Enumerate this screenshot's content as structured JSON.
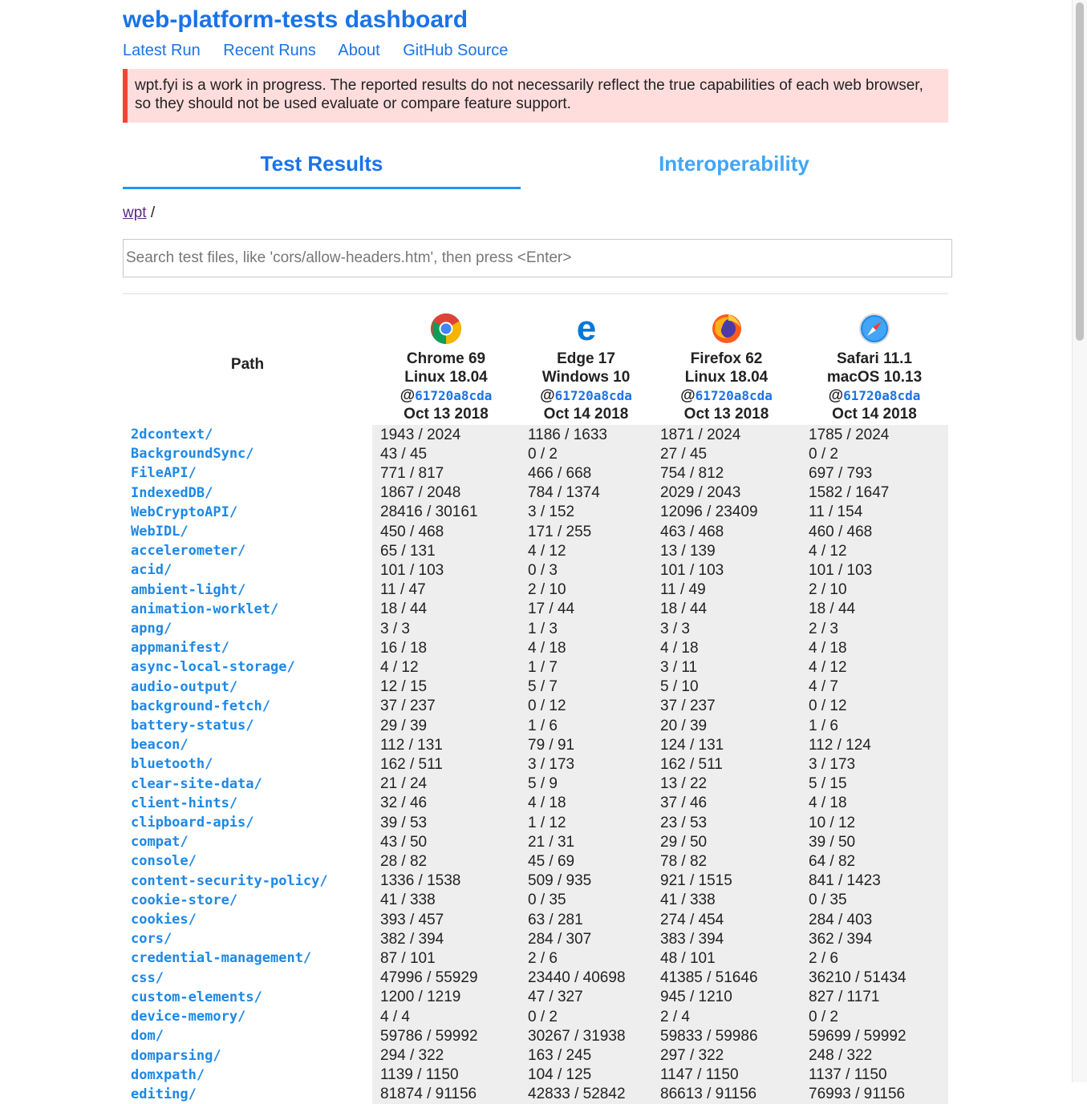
{
  "header": {
    "title": "web-platform-tests dashboard",
    "nav": [
      "Latest Run",
      "Recent Runs",
      "About",
      "GitHub Source"
    ]
  },
  "warning": "wpt.fyi is a work in progress. The reported results do not necessarily reflect the true capabilities of each web browser, so they should not be used evaluate or compare feature support.",
  "tabs": {
    "results": "Test Results",
    "interop": "Interoperability",
    "active": "Test Results"
  },
  "breadcrumb": {
    "root": "wpt",
    "separator": "/"
  },
  "search": {
    "placeholder": "Search test files, like 'cors/allow-headers.htm', then press <Enter>",
    "value": ""
  },
  "table": {
    "path_header": "Path",
    "browsers": [
      {
        "icon": "chrome-icon",
        "name": "Chrome 69",
        "os": "Linux 18.04",
        "at": "@",
        "sha": "61720a8cda",
        "date": "Oct 13 2018"
      },
      {
        "icon": "edge-icon",
        "name": "Edge 17",
        "os": "Windows 10",
        "at": "@",
        "sha": "61720a8cda",
        "date": "Oct 14 2018"
      },
      {
        "icon": "firefox-icon",
        "name": "Firefox 62",
        "os": "Linux 18.04",
        "at": "@",
        "sha": "61720a8cda",
        "date": "Oct 13 2018"
      },
      {
        "icon": "safari-icon",
        "name": "Safari 11.1",
        "os": "macOS 10.13",
        "at": "@",
        "sha": "61720a8cda",
        "date": "Oct 14 2018"
      }
    ],
    "rows": [
      {
        "path": "2dcontext/",
        "results": [
          "1943 / 2024",
          "1186 / 1633",
          "1871 / 2024",
          "1785 / 2024"
        ]
      },
      {
        "path": "BackgroundSync/",
        "results": [
          "43 / 45",
          "0 / 2",
          "27 / 45",
          "0 / 2"
        ]
      },
      {
        "path": "FileAPI/",
        "results": [
          "771 / 817",
          "466 / 668",
          "754 / 812",
          "697 / 793"
        ]
      },
      {
        "path": "IndexedDB/",
        "results": [
          "1867 / 2048",
          "784 / 1374",
          "2029 / 2043",
          "1582 / 1647"
        ]
      },
      {
        "path": "WebCryptoAPI/",
        "results": [
          "28416 / 30161",
          "3 / 152",
          "12096 / 23409",
          "11 / 154"
        ]
      },
      {
        "path": "WebIDL/",
        "results": [
          "450 / 468",
          "171 / 255",
          "463 / 468",
          "460 / 468"
        ]
      },
      {
        "path": "accelerometer/",
        "results": [
          "65 / 131",
          "4 / 12",
          "13 / 139",
          "4 / 12"
        ]
      },
      {
        "path": "acid/",
        "results": [
          "101 / 103",
          "0 / 3",
          "101 / 103",
          "101 / 103"
        ]
      },
      {
        "path": "ambient-light/",
        "results": [
          "11 / 47",
          "2 / 10",
          "11 / 49",
          "2 / 10"
        ]
      },
      {
        "path": "animation-worklet/",
        "results": [
          "18 / 44",
          "17 / 44",
          "18 / 44",
          "18 / 44"
        ]
      },
      {
        "path": "apng/",
        "results": [
          "3 / 3",
          "1 / 3",
          "3 / 3",
          "2 / 3"
        ]
      },
      {
        "path": "appmanifest/",
        "results": [
          "16 / 18",
          "4 / 18",
          "4 / 18",
          "4 / 18"
        ]
      },
      {
        "path": "async-local-storage/",
        "results": [
          "4 / 12",
          "1 / 7",
          "3 / 11",
          "4 / 12"
        ]
      },
      {
        "path": "audio-output/",
        "results": [
          "12 / 15",
          "5 / 7",
          "5 / 10",
          "4 / 7"
        ]
      },
      {
        "path": "background-fetch/",
        "results": [
          "37 / 237",
          "0 / 12",
          "37 / 237",
          "0 / 12"
        ]
      },
      {
        "path": "battery-status/",
        "results": [
          "29 / 39",
          "1 / 6",
          "20 / 39",
          "1 / 6"
        ]
      },
      {
        "path": "beacon/",
        "results": [
          "112 / 131",
          "79 / 91",
          "124 / 131",
          "112 / 124"
        ]
      },
      {
        "path": "bluetooth/",
        "results": [
          "162 / 511",
          "3 / 173",
          "162 / 511",
          "3 / 173"
        ]
      },
      {
        "path": "clear-site-data/",
        "results": [
          "21 / 24",
          "5 / 9",
          "13 / 22",
          "5 / 15"
        ]
      },
      {
        "path": "client-hints/",
        "results": [
          "32 / 46",
          "4 / 18",
          "37 / 46",
          "4 / 18"
        ]
      },
      {
        "path": "clipboard-apis/",
        "results": [
          "39 / 53",
          "1 / 12",
          "23 / 53",
          "10 / 12"
        ]
      },
      {
        "path": "compat/",
        "results": [
          "43 / 50",
          "21 / 31",
          "29 / 50",
          "39 / 50"
        ]
      },
      {
        "path": "console/",
        "results": [
          "28 / 82",
          "45 / 69",
          "78 / 82",
          "64 / 82"
        ]
      },
      {
        "path": "content-security-policy/",
        "results": [
          "1336 / 1538",
          "509 / 935",
          "921 / 1515",
          "841 / 1423"
        ]
      },
      {
        "path": "cookie-store/",
        "results": [
          "41 / 338",
          "0 / 35",
          "41 / 338",
          "0 / 35"
        ]
      },
      {
        "path": "cookies/",
        "results": [
          "393 / 457",
          "63 / 281",
          "274 / 454",
          "284 / 403"
        ]
      },
      {
        "path": "cors/",
        "results": [
          "382 / 394",
          "284 / 307",
          "383 / 394",
          "362 / 394"
        ]
      },
      {
        "path": "credential-management/",
        "results": [
          "87 / 101",
          "2 / 6",
          "48 / 101",
          "2 / 6"
        ]
      },
      {
        "path": "css/",
        "results": [
          "47996 / 55929",
          "23440 / 40698",
          "41385 / 51646",
          "36210 / 51434"
        ]
      },
      {
        "path": "custom-elements/",
        "results": [
          "1200 / 1219",
          "47 / 327",
          "945 / 1210",
          "827 / 1171"
        ]
      },
      {
        "path": "device-memory/",
        "results": [
          "4 / 4",
          "0 / 2",
          "2 / 4",
          "0 / 2"
        ]
      },
      {
        "path": "dom/",
        "results": [
          "59786 / 59992",
          "30267 / 31938",
          "59833 / 59986",
          "59699 / 59992"
        ]
      },
      {
        "path": "domparsing/",
        "results": [
          "294 / 322",
          "163 / 245",
          "297 / 322",
          "248 / 322"
        ]
      },
      {
        "path": "domxpath/",
        "results": [
          "1139 / 1150",
          "104 / 125",
          "1147 / 1150",
          "1137 / 1150"
        ]
      },
      {
        "path": "editing/",
        "results": [
          "81874 / 91156",
          "42833 / 52842",
          "86613 / 91156",
          "76993 / 91156"
        ]
      }
    ]
  },
  "colors": {
    "accent": "#1a73e8",
    "path_link": "#1e88e5",
    "warning_bg": "#ffdddd",
    "warning_border": "#f44336",
    "cell_bg": "#eeeeee"
  }
}
